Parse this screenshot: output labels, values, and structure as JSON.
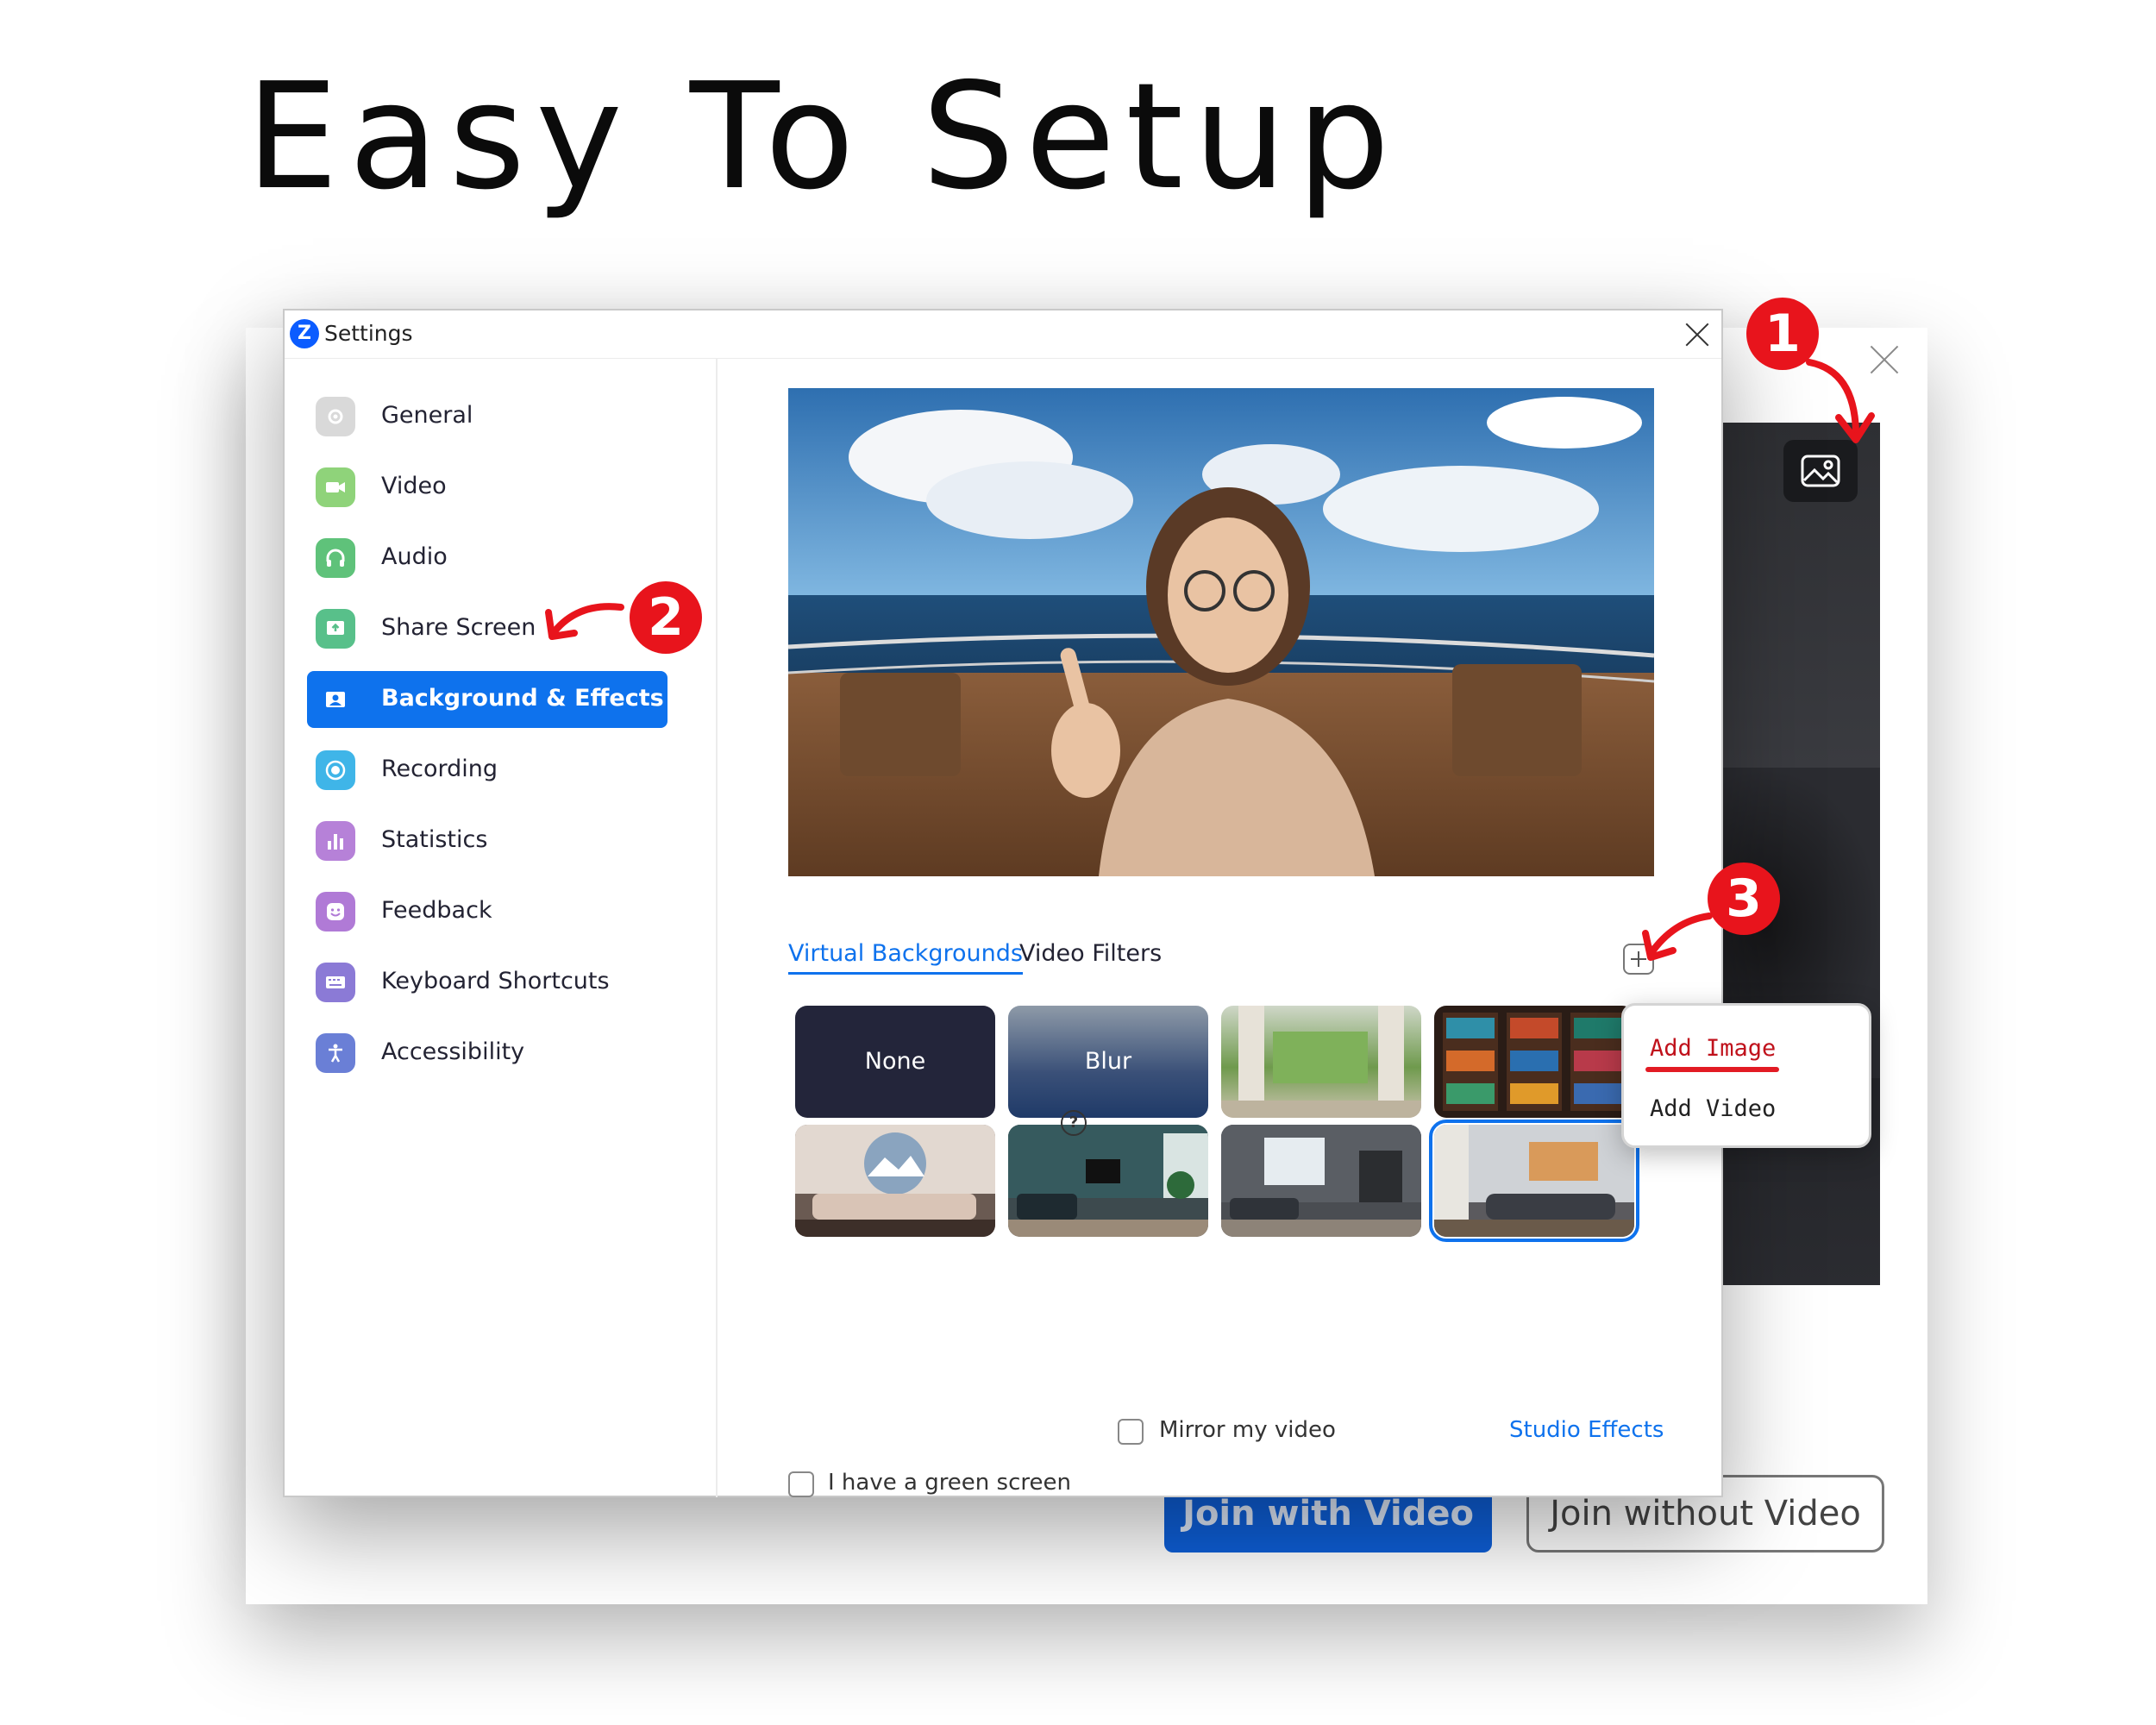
{
  "headline": "Easy To Setup",
  "background_window": {
    "join_with_video": "Join with Video",
    "join_without_video": "Join without Video"
  },
  "settings": {
    "title": "Settings",
    "logo_letter": "Z",
    "nav": [
      {
        "label": "General",
        "icon": "gear-icon",
        "color": "#d9d9d9"
      },
      {
        "label": "Video",
        "icon": "camera-icon",
        "color": "#8fd37a"
      },
      {
        "label": "Audio",
        "icon": "headphones-icon",
        "color": "#5fc27a"
      },
      {
        "label": "Share Screen",
        "icon": "share-screen-icon",
        "color": "#58c08a"
      },
      {
        "label": "Background & Effects",
        "icon": "person-card-icon",
        "color": "#0e72ed"
      },
      {
        "label": "Recording",
        "icon": "record-icon",
        "color": "#3fb5e8"
      },
      {
        "label": "Statistics",
        "icon": "bar-chart-icon",
        "color": "#b681d8"
      },
      {
        "label": "Feedback",
        "icon": "smiley-icon",
        "color": "#b07ad6"
      },
      {
        "label": "Keyboard Shortcuts",
        "icon": "keyboard-icon",
        "color": "#8b7ad6"
      },
      {
        "label": "Accessibility",
        "icon": "accessibility-icon",
        "color": "#6a7fd6"
      }
    ],
    "active_nav": "Background & Effects",
    "tabs": {
      "virtual_backgrounds": "Virtual Backgrounds",
      "video_filters": "Video Filters"
    },
    "thumbnails": [
      {
        "label": "None"
      },
      {
        "label": "Blur"
      },
      {
        "label": ""
      },
      {
        "label": ""
      },
      {
        "label": ""
      },
      {
        "label": ""
      },
      {
        "label": ""
      },
      {
        "label": ""
      }
    ],
    "green_screen_label": "I have a green screen",
    "mirror_label": "Mirror my video",
    "studio_effects": "Studio Effects"
  },
  "add_menu": {
    "add_image": "Add  Image",
    "add_video": "Add  Video"
  },
  "steps": [
    "1",
    "2",
    "3"
  ],
  "colors": {
    "accent": "#0e72ed",
    "annotation_red": "#e8141c"
  }
}
